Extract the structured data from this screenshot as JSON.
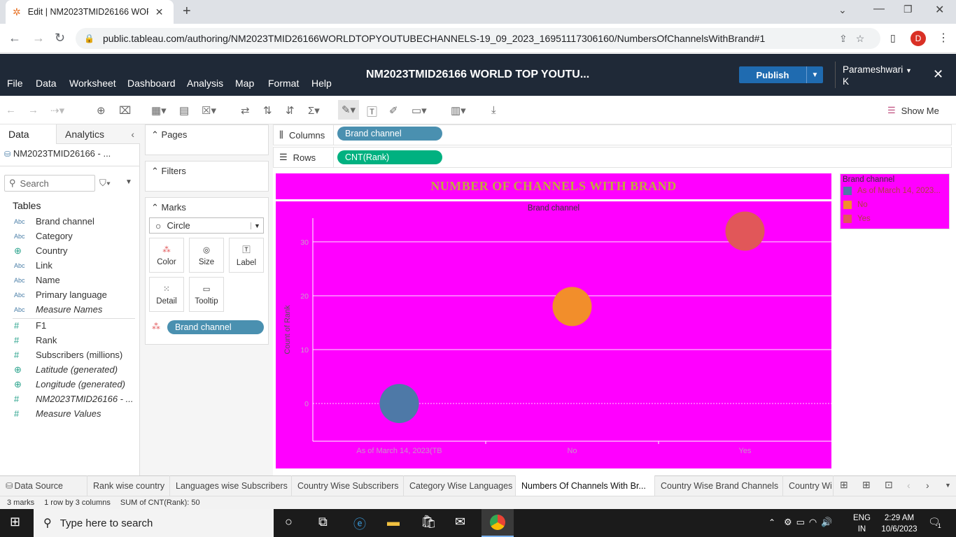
{
  "browser": {
    "tab_title": "Edit | NM2023TMID26166 WORL",
    "url": "public.tableau.com/authoring/NM2023TMID26166WORLDTOPYOUTUBECHANNELS-19_09_2023_16951117306160/NumbersOfChannelsWithBrand#1",
    "profile_initial": "D"
  },
  "menu": [
    "File",
    "Data",
    "Worksheet",
    "Dashboard",
    "Analysis",
    "Map",
    "Format",
    "Help"
  ],
  "workbook_title": "NM2023TMID26166 WORLD TOP YOUTU...",
  "publish_label": "Publish",
  "user": {
    "line1": "Parameshwari",
    "line2": "K"
  },
  "show_me": "Show Me",
  "data_pane": {
    "tab_data": "Data",
    "tab_analytics": "Analytics",
    "datasource": "NM2023TMID26166 - ...",
    "search_placeholder": "Search",
    "tables_heading": "Tables",
    "dimensions": [
      {
        "type": "Abc",
        "name": "Brand channel"
      },
      {
        "type": "Abc",
        "name": "Category"
      },
      {
        "type": "globe",
        "name": "Country"
      },
      {
        "type": "Abc",
        "name": "Link"
      },
      {
        "type": "Abc",
        "name": "Name"
      },
      {
        "type": "Abc",
        "name": "Primary language"
      },
      {
        "type": "Abc",
        "name": "Measure Names"
      }
    ],
    "measures": [
      {
        "type": "#",
        "name": "F1"
      },
      {
        "type": "#",
        "name": "Rank"
      },
      {
        "type": "#",
        "name": "Subscribers (millions)"
      },
      {
        "type": "globe",
        "name": "Latitude (generated)"
      },
      {
        "type": "globe",
        "name": "Longitude (generated)"
      },
      {
        "type": "#",
        "name": "NM2023TMID26166 - ..."
      },
      {
        "type": "#",
        "name": "Measure Values"
      }
    ]
  },
  "cards": {
    "pages": "Pages",
    "filters": "Filters",
    "marks": "Marks",
    "mark_type": "Circle",
    "buttons": {
      "color": "Color",
      "size": "Size",
      "label": "Label",
      "detail": "Detail",
      "tooltip": "Tooltip"
    },
    "marks_pill": "Brand channel"
  },
  "shelves": {
    "columns_label": "Columns",
    "columns_pill": "Brand channel",
    "rows_label": "Rows",
    "rows_pill": "CNT(Rank)"
  },
  "viz": {
    "title": "NUMBER OF CHANNELS WITH BRAND",
    "header": "Brand channel",
    "bg": "#ff00ff"
  },
  "legend": {
    "title": "Brand channel",
    "items": [
      {
        "label": "As of March 14, 2023...",
        "color": "#4e79a7"
      },
      {
        "label": "No",
        "color": "#f28e2b"
      },
      {
        "label": "Yes",
        "color": "#e15759"
      }
    ]
  },
  "chart_data": {
    "type": "scatter",
    "xlabel": "",
    "ylabel": "Count of Rank",
    "categories": [
      "As of March 14, 2023(TB",
      "No",
      "Yes"
    ],
    "y_ticks": [
      0,
      10,
      20,
      30
    ],
    "ylim": [
      -7,
      37
    ],
    "values": [
      0,
      18,
      32
    ],
    "colors": [
      "#4e79a7",
      "#f28e2b",
      "#e15759"
    ]
  },
  "sheet_tabs": [
    "Data Source",
    "Rank wise country",
    "Languages wise Subscribers",
    "Country Wise Subscribers",
    "Category Wise Languages",
    "Numbers Of Channels With Br...",
    "Country Wise Brand Channels",
    "Country Wi"
  ],
  "active_tab": "Numbers Of Channels With Br...",
  "status": {
    "marks": "3 marks",
    "rows": "1 row by 3 columns",
    "sum": "SUM of CNT(Rank): 50"
  },
  "taskbar": {
    "search": "Type here to search",
    "lang1": "ENG",
    "lang2": "IN",
    "time": "2:29 AM",
    "date": "10/6/2023",
    "notif": "1"
  }
}
